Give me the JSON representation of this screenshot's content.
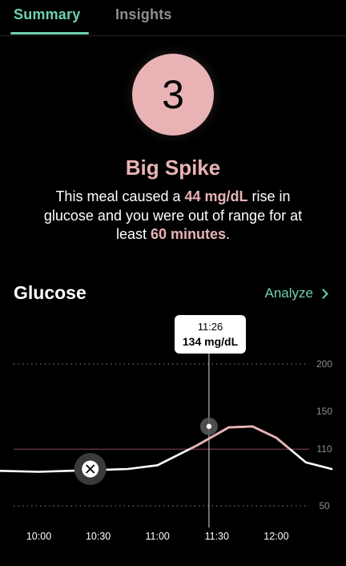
{
  "tabs": {
    "summary": "Summary",
    "insights": "Insights",
    "active": "summary"
  },
  "score": {
    "value": "3",
    "rating": "Big Spike",
    "description": {
      "part1": "This meal caused a ",
      "rise": "44 mg/dL",
      "part2": " rise in glucose and you were out of range for at least ",
      "duration": "60 minutes",
      "part3": "."
    }
  },
  "glucose_section": {
    "title": "Glucose",
    "analyze_label": "Analyze",
    "tooltip": {
      "time": "11:26",
      "value": "134 mg/dL"
    }
  },
  "colors": {
    "accent": "#6fd0b4",
    "spike": "#e9b3b5",
    "range_line": "#8a4a55"
  },
  "icons": {
    "meal_marker": "fork-knife-icon",
    "analyze": "chevron-right-icon"
  },
  "chart_data": {
    "type": "line",
    "title": "Glucose",
    "x_ticks": [
      "10:00",
      "10:30",
      "11:00",
      "11:30",
      "12:00"
    ],
    "y_ticks": [
      200,
      150,
      110,
      50
    ],
    "ylim": [
      50,
      200
    ],
    "xlim_minutes": [
      -20,
      148
    ],
    "threshold": 110,
    "series": [
      {
        "x_minutes": [
          -20,
          0,
          15,
          30,
          45,
          60,
          80,
          96,
          108,
          120,
          135,
          148
        ],
        "values": [
          87,
          86,
          87,
          88,
          89,
          93,
          114,
          133,
          134,
          122,
          96,
          89
        ]
      }
    ],
    "meal_marker_minutes": 26,
    "selected_minutes": 86,
    "selected_value": 134
  }
}
